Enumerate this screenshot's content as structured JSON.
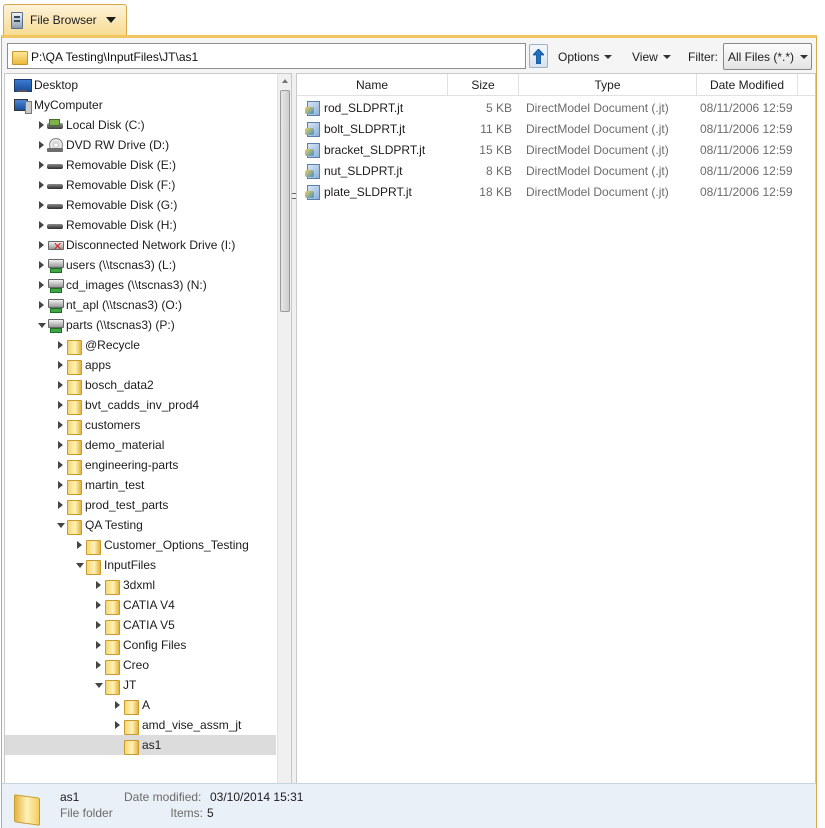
{
  "tab": {
    "label": "File Browser"
  },
  "toolbar": {
    "path": "P:\\QA Testing\\InputFiles\\JT\\as1",
    "options_label": "Options",
    "view_label": "View",
    "filter_label": "Filter:",
    "filter_value": "All Files (*.*)"
  },
  "tree": [
    {
      "label": "Desktop",
      "icon": "desktop-icon",
      "depth": 0,
      "state": "none"
    },
    {
      "label": "MyComputer",
      "icon": "computer-icon",
      "depth": 0,
      "state": "expanded"
    },
    {
      "label": "Local Disk (C:)",
      "icon": "drive-icon",
      "depth": 1,
      "state": "collapsed"
    },
    {
      "label": "DVD RW Drive (D:)",
      "icon": "dvd-icon",
      "depth": 1,
      "state": "collapsed"
    },
    {
      "label": "Removable Disk (E:)",
      "icon": "removable-disk-icon",
      "depth": 1,
      "state": "collapsed"
    },
    {
      "label": "Removable Disk (F:)",
      "icon": "removable-disk-icon",
      "depth": 1,
      "state": "collapsed"
    },
    {
      "label": "Removable Disk (G:)",
      "icon": "removable-disk-icon",
      "depth": 1,
      "state": "collapsed"
    },
    {
      "label": "Removable Disk (H:)",
      "icon": "removable-disk-icon",
      "depth": 1,
      "state": "collapsed"
    },
    {
      "label": "Disconnected Network Drive (I:)",
      "icon": "disconnected-drive-icon",
      "depth": 1,
      "state": "collapsed"
    },
    {
      "label": "users (\\\\tscnas3) (L:)",
      "icon": "network-drive-icon",
      "depth": 1,
      "state": "collapsed"
    },
    {
      "label": "cd_images (\\\\tscnas3) (N:)",
      "icon": "network-drive-icon",
      "depth": 1,
      "state": "collapsed"
    },
    {
      "label": "nt_apl (\\\\tscnas3) (O:)",
      "icon": "network-drive-icon",
      "depth": 1,
      "state": "collapsed"
    },
    {
      "label": "parts (\\\\tscnas3) (P:)",
      "icon": "network-drive-icon",
      "depth": 1,
      "state": "expanded"
    },
    {
      "label": "@Recycle",
      "icon": "folder-icon",
      "depth": 2,
      "state": "collapsed"
    },
    {
      "label": "apps",
      "icon": "folder-icon",
      "depth": 2,
      "state": "collapsed"
    },
    {
      "label": "bosch_data2",
      "icon": "folder-icon",
      "depth": 2,
      "state": "collapsed"
    },
    {
      "label": "bvt_cadds_inv_prod4",
      "icon": "folder-icon",
      "depth": 2,
      "state": "collapsed"
    },
    {
      "label": "customers",
      "icon": "folder-icon",
      "depth": 2,
      "state": "collapsed"
    },
    {
      "label": "demo_material",
      "icon": "folder-icon",
      "depth": 2,
      "state": "collapsed"
    },
    {
      "label": "engineering-parts",
      "icon": "folder-icon",
      "depth": 2,
      "state": "collapsed"
    },
    {
      "label": "martin_test",
      "icon": "folder-icon",
      "depth": 2,
      "state": "collapsed"
    },
    {
      "label": "prod_test_parts",
      "icon": "folder-icon",
      "depth": 2,
      "state": "collapsed"
    },
    {
      "label": "QA Testing",
      "icon": "folder-icon",
      "depth": 2,
      "state": "expanded"
    },
    {
      "label": "Customer_Options_Testing",
      "icon": "folder-icon",
      "depth": 3,
      "state": "collapsed"
    },
    {
      "label": "InputFiles",
      "icon": "folder-icon",
      "depth": 3,
      "state": "expanded"
    },
    {
      "label": "3dxml",
      "icon": "folder-icon",
      "depth": 4,
      "state": "collapsed"
    },
    {
      "label": "CATIA V4",
      "icon": "folder-icon",
      "depth": 4,
      "state": "collapsed"
    },
    {
      "label": "CATIA V5",
      "icon": "folder-icon",
      "depth": 4,
      "state": "collapsed"
    },
    {
      "label": "Config Files",
      "icon": "folder-icon",
      "depth": 4,
      "state": "collapsed"
    },
    {
      "label": "Creo",
      "icon": "folder-icon",
      "depth": 4,
      "state": "collapsed"
    },
    {
      "label": "JT",
      "icon": "folder-icon",
      "depth": 4,
      "state": "expanded"
    },
    {
      "label": "A",
      "icon": "folder-icon",
      "depth": 5,
      "state": "collapsed"
    },
    {
      "label": "amd_vise_assm_jt",
      "icon": "folder-icon",
      "depth": 5,
      "state": "collapsed"
    },
    {
      "label": "as1",
      "icon": "folder-icon",
      "depth": 5,
      "state": "none",
      "selected": true
    }
  ],
  "file_list": {
    "columns": [
      "Name",
      "Size",
      "Type",
      "Date Modified"
    ],
    "rows": [
      {
        "name": "rod_SLDPRT.jt",
        "size": "5 KB",
        "type": "DirectModel Document (.jt)",
        "date": "08/11/2006 12:59"
      },
      {
        "name": "bolt_SLDPRT.jt",
        "size": "11 KB",
        "type": "DirectModel Document (.jt)",
        "date": "08/11/2006 12:59"
      },
      {
        "name": "bracket_SLDPRT.jt",
        "size": "15 KB",
        "type": "DirectModel Document (.jt)",
        "date": "08/11/2006 12:59"
      },
      {
        "name": "nut_SLDPRT.jt",
        "size": "8 KB",
        "type": "DirectModel Document (.jt)",
        "date": "08/11/2006 12:59"
      },
      {
        "name": "plate_SLDPRT.jt",
        "size": "18 KB",
        "type": "DirectModel Document (.jt)",
        "date": "08/11/2006 12:59"
      }
    ]
  },
  "details": {
    "name": "as1",
    "type": "File folder",
    "modified_label": "Date modified:",
    "modified_value": "03/10/2014 15:31",
    "items_label": "Items:",
    "items_value": "5"
  },
  "colors": {
    "tab_accent": "#f2c65f",
    "selection": "#dcdcdc",
    "details_bg": "#eaf0f7"
  }
}
